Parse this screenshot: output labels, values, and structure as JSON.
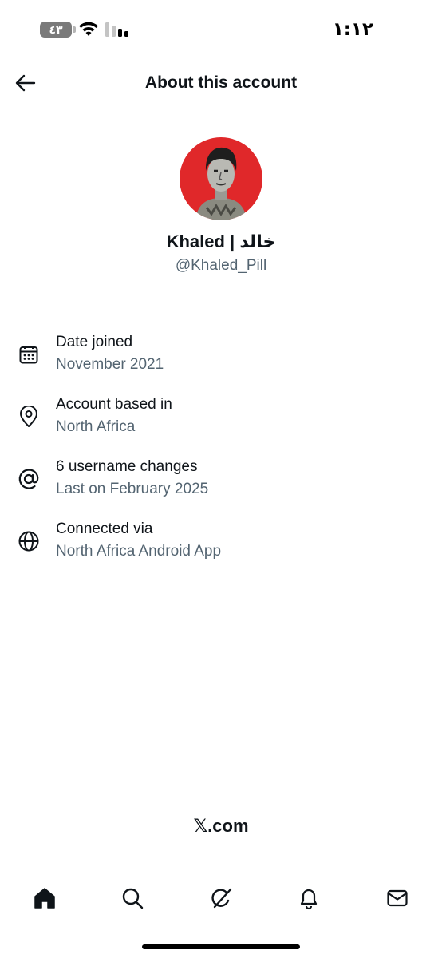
{
  "status_bar": {
    "battery_level": "٤٣",
    "time": "١:١٢"
  },
  "header": {
    "title": "About this account",
    "back_icon": "arrow-left-icon"
  },
  "profile": {
    "display_name": "Khaled | خالد",
    "handle": "@Khaled_Pill",
    "avatar_bg": "#e0282a"
  },
  "info": [
    {
      "icon": "calendar-icon",
      "title": "Date joined",
      "subtitle": "November 2021"
    },
    {
      "icon": "location-pin-icon",
      "title": "Account based in",
      "subtitle": "North Africa"
    },
    {
      "icon": "at-sign-icon",
      "title": "6 username changes",
      "subtitle": "Last on February 2025"
    },
    {
      "icon": "globe-icon",
      "title": "Connected via",
      "subtitle": "North Africa Android App"
    }
  ],
  "footer": {
    "brand": "𝕏.com"
  },
  "bottom_nav": [
    "home-icon",
    "search-icon",
    "grok-icon",
    "bell-icon",
    "mail-icon"
  ],
  "colors": {
    "text": "#0f1419",
    "secondary": "#536471",
    "accent": "#e0282a"
  }
}
